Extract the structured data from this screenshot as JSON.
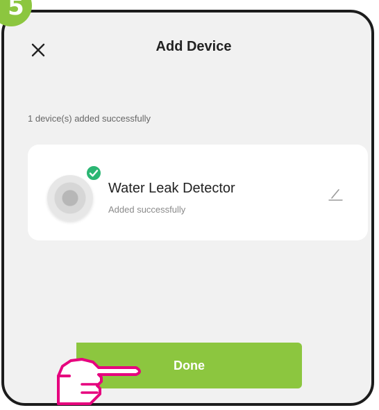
{
  "step": {
    "number": "5"
  },
  "header": {
    "title": "Add Device",
    "close_icon": "close-icon"
  },
  "summary": {
    "text": "1 device(s) added successfully"
  },
  "device": {
    "name": "Water Leak Detector",
    "status": "Added successfully",
    "check_icon": "check-icon",
    "edit_icon": "edit-icon"
  },
  "footer": {
    "done_label": "Done",
    "pointer_icon": "hand-pointer-icon"
  },
  "colors": {
    "accent": "#8cc63f",
    "success": "#2bb673",
    "pointer": "#e6007e"
  }
}
